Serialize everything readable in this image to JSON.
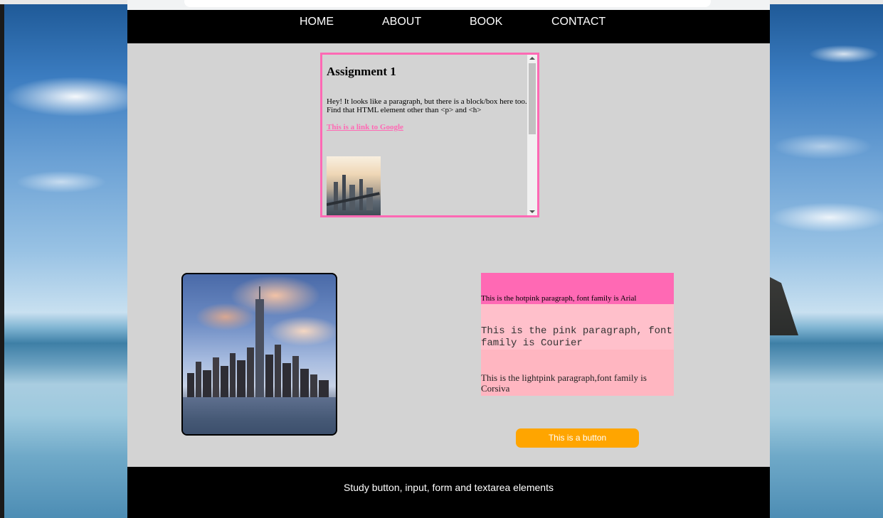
{
  "nav": {
    "items": [
      {
        "label": "HOME"
      },
      {
        "label": "ABOUT"
      },
      {
        "label": "BOOK"
      },
      {
        "label": "CONTACT"
      }
    ]
  },
  "assignment": {
    "title": "Assignment 1",
    "paragraph": "Hey! It looks like a paragraph, but there is a block/box here too. Find that HTML element other than <p> and <h>",
    "link_text": "This is a link to Google"
  },
  "paragraphs": {
    "hotpink": "This is the hotpink paragraph, font family is Arial",
    "pink": "This is the pink paragraph, font family is Courier",
    "lightpink": "This is the lightpink paragraph,font family is Corsiva"
  },
  "button": {
    "label": "This is a button"
  },
  "footer": {
    "text": "Study button, input, form and textarea elements"
  },
  "colors": {
    "nav_bg": "#000000",
    "page_bg": "#d3d3d3",
    "hotpink": "#ff69b4",
    "pink": "#ffc0cb",
    "lightpink": "#ffb6c1",
    "button": "#ffa500"
  }
}
